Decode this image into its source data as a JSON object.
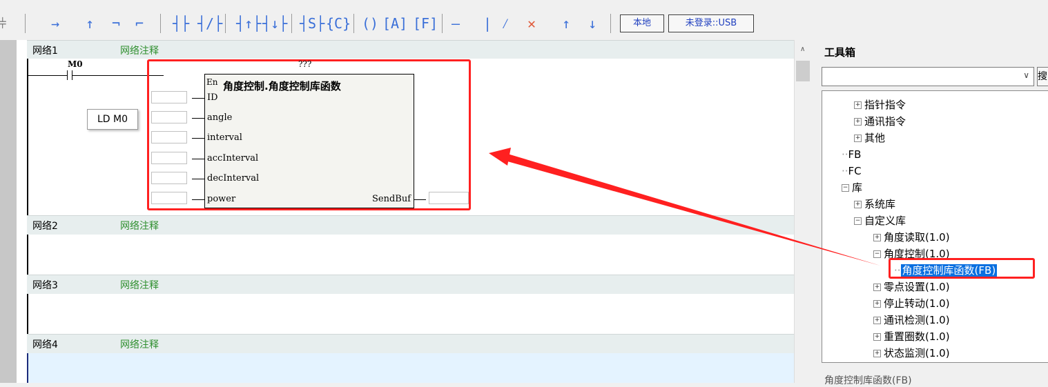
{
  "toolbar": {
    "btn_local": "本地",
    "btn_login": "未登录::USB",
    "icons": [
      "branch-left-icon",
      "hline-right-icon",
      "vline-up-icon",
      "corner-icon",
      "corner-right-icon",
      "no-contact-icon",
      "nc-contact-icon",
      "rising-contact-icon",
      "falling-contact-icon",
      "set-reset-icon",
      "compare-icon",
      "coil-icon",
      "a-box-icon",
      "f-box-icon",
      "hline-icon",
      "vline-icon",
      "diag-icon",
      "asterisk-icon",
      "arrow-up-icon",
      "arrow-down-icon"
    ]
  },
  "editor": {
    "networks": [
      {
        "name": "网络1",
        "comment": "网络注释"
      },
      {
        "name": "网络2",
        "comment": "网络注释"
      },
      {
        "name": "网络3",
        "comment": "网络注释"
      },
      {
        "name": "网络4",
        "comment": "网络注释"
      }
    ],
    "contact_label": "M0",
    "tooltip": "LD M0",
    "block": {
      "instance": "???",
      "en": "En",
      "title": "角度控制.角度控制库函数",
      "inputs": [
        "ID",
        "angle",
        "interval",
        "accInterval",
        "decInterval",
        "power"
      ],
      "output": "SendBuf"
    }
  },
  "toolbox": {
    "title": "工具箱",
    "search_value": "",
    "search_btn": "搜",
    "tree": [
      {
        "label": "指针指令",
        "pm": "+"
      },
      {
        "label": "通讯指令",
        "pm": "+"
      },
      {
        "label": "其他",
        "pm": "+"
      },
      {
        "label": "FB",
        "pm": ""
      },
      {
        "label": "FC",
        "pm": ""
      },
      {
        "label": "库",
        "pm": "-"
      },
      {
        "label": "系统库",
        "pm": "+"
      },
      {
        "label": "自定义库",
        "pm": "-"
      },
      {
        "label": "角度读取(1.0)",
        "pm": "+"
      },
      {
        "label": "角度控制(1.0)",
        "pm": "-"
      },
      {
        "label": "角度控制库函数(FB)",
        "pm": ""
      },
      {
        "label": "零点设置(1.0)",
        "pm": "+"
      },
      {
        "label": "停止转动(1.0)",
        "pm": "+"
      },
      {
        "label": "通讯检测(1.0)",
        "pm": "+"
      },
      {
        "label": "重置圈数(1.0)",
        "pm": "+"
      },
      {
        "label": "状态监测(1.0)",
        "pm": "+"
      }
    ],
    "status": "角度控制库函数(FB)"
  },
  "colors": {
    "highlight": "#ff2020",
    "selection": "#0a6fe0",
    "comment": "#2f8f2f"
  }
}
